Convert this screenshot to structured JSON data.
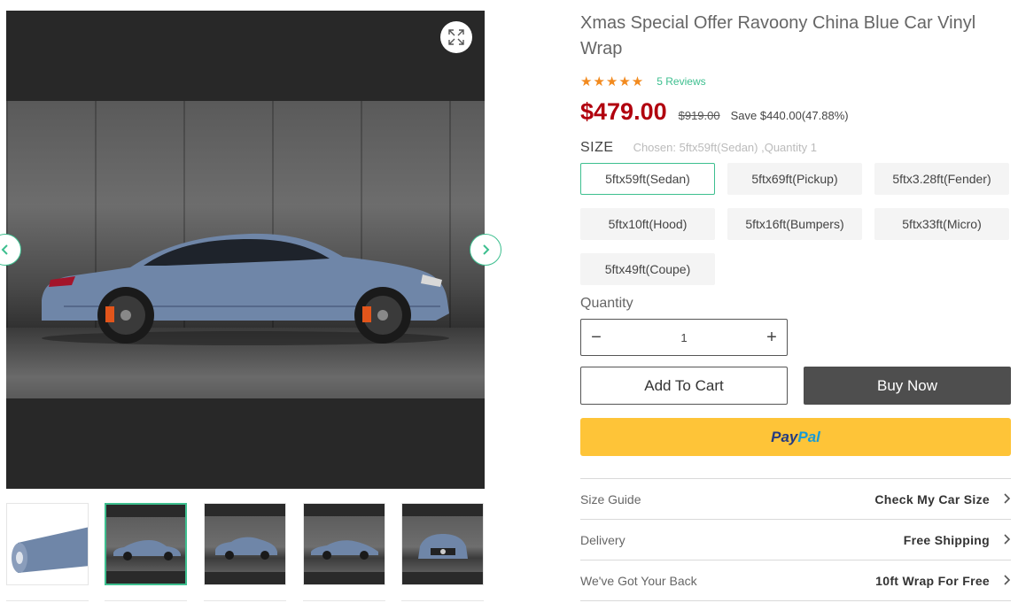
{
  "product": {
    "title": "Xmas Special Offer Ravoony China Blue Car Vinyl Wrap",
    "stars": "★★★★★",
    "rating": 5,
    "reviews_label": "5 Reviews",
    "price": "$479.00",
    "compare_price": "$919.00",
    "save_text": "Save $440.00(47.88%)"
  },
  "size": {
    "label": "SIZE",
    "chosen_text": "Chosen: 5ftx59ft(Sedan) ,Quantity 1",
    "options": [
      "5ftx59ft(Sedan)",
      "5ftx69ft(Pickup)",
      "5ftx3.28ft(Fender)",
      "5ftx10ft(Hood)",
      "5ftx16ft(Bumpers)",
      "5ftx33ft(Micro)",
      "5ftx49ft(Coupe)"
    ],
    "selected": "5ftx59ft(Sedan)"
  },
  "quantity": {
    "label": "Quantity",
    "minus": "−",
    "plus": "+",
    "value": "1"
  },
  "actions": {
    "add_to_cart": "Add To Cart",
    "buy_now": "Buy Now",
    "paypal_part1": "Pay",
    "paypal_part2": "Pal"
  },
  "info": [
    {
      "label": "Size Guide",
      "value": "Check My Car Size"
    },
    {
      "label": "Delivery",
      "value": "Free Shipping"
    },
    {
      "label": "We've Got Your Back",
      "value": "10ft Wrap For Free"
    }
  ],
  "gallery": {
    "thumbnail_count": 5,
    "active_thumbnail": 2
  },
  "colors": {
    "accent": "#3dbf8f",
    "price": "#b1000e",
    "star": "#f28a1e",
    "buy_button": "#4e4e4e",
    "paypal": "#fec438",
    "car_paint": "#6f86a8"
  }
}
